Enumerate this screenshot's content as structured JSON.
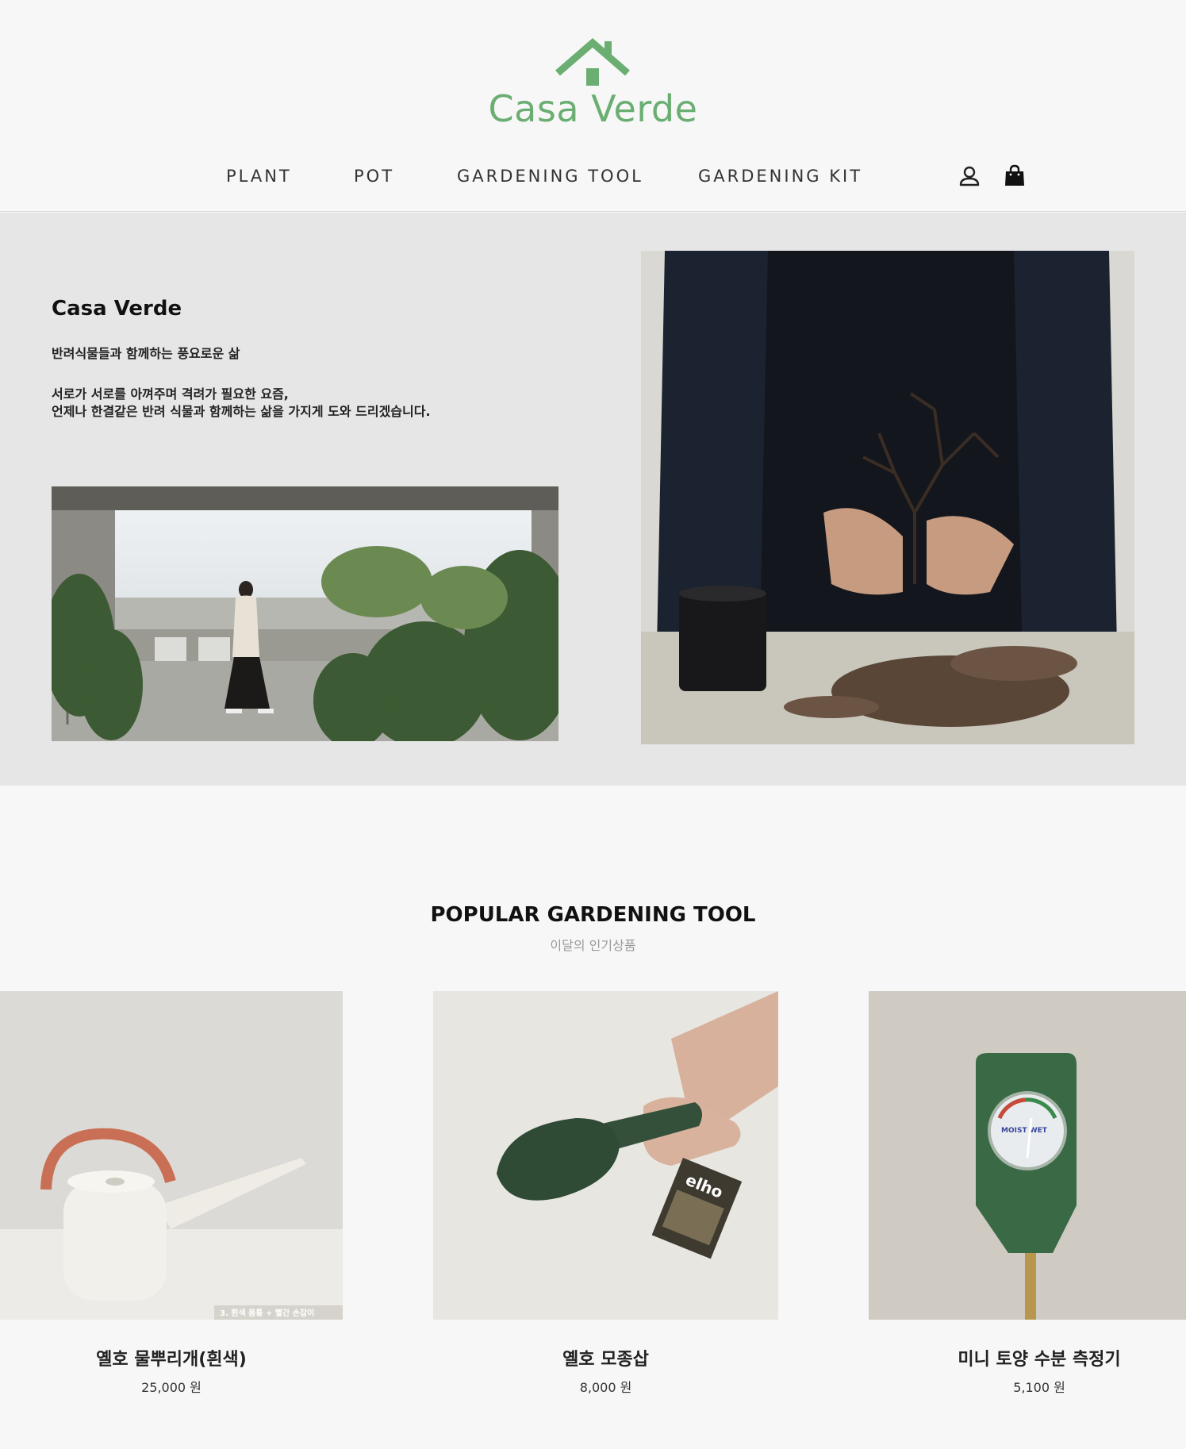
{
  "brand": {
    "name": "Casa Verde",
    "accent_color": "#6aae72"
  },
  "nav": {
    "items": [
      {
        "label": "PLANT"
      },
      {
        "label": "POT"
      },
      {
        "label": "GARDENING TOOL"
      },
      {
        "label": "GARDENING KIT"
      }
    ],
    "icons": [
      "user-icon",
      "shopping-bag-icon"
    ]
  },
  "hero": {
    "title": "Casa Verde",
    "subtitle": "반려식물들과 함께하는 풍요로운 삶",
    "description_lines": [
      "서로가 서로를 아껴주며 격려가 필요한 요즘,",
      "언제나 한결같은 반려 식물과 함께하는 삶을 가지게 도와 드리겠습니다."
    ]
  },
  "popular": {
    "title": "POPULAR GARDENING TOOL",
    "subtitle": "이달의 인기상품",
    "products": [
      {
        "name": "옐호 물뿌리개(흰색)",
        "price": "25,000 원",
        "image_caption": "3. 흰색 몸통 + 빨간 손잡이"
      },
      {
        "name": "옐호 모종삽",
        "price": "8,000 원",
        "image_caption": "elho"
      },
      {
        "name": "미니 토양 수분 측정기",
        "price": "5,100 원",
        "image_caption": "MOIST  WET"
      }
    ]
  }
}
